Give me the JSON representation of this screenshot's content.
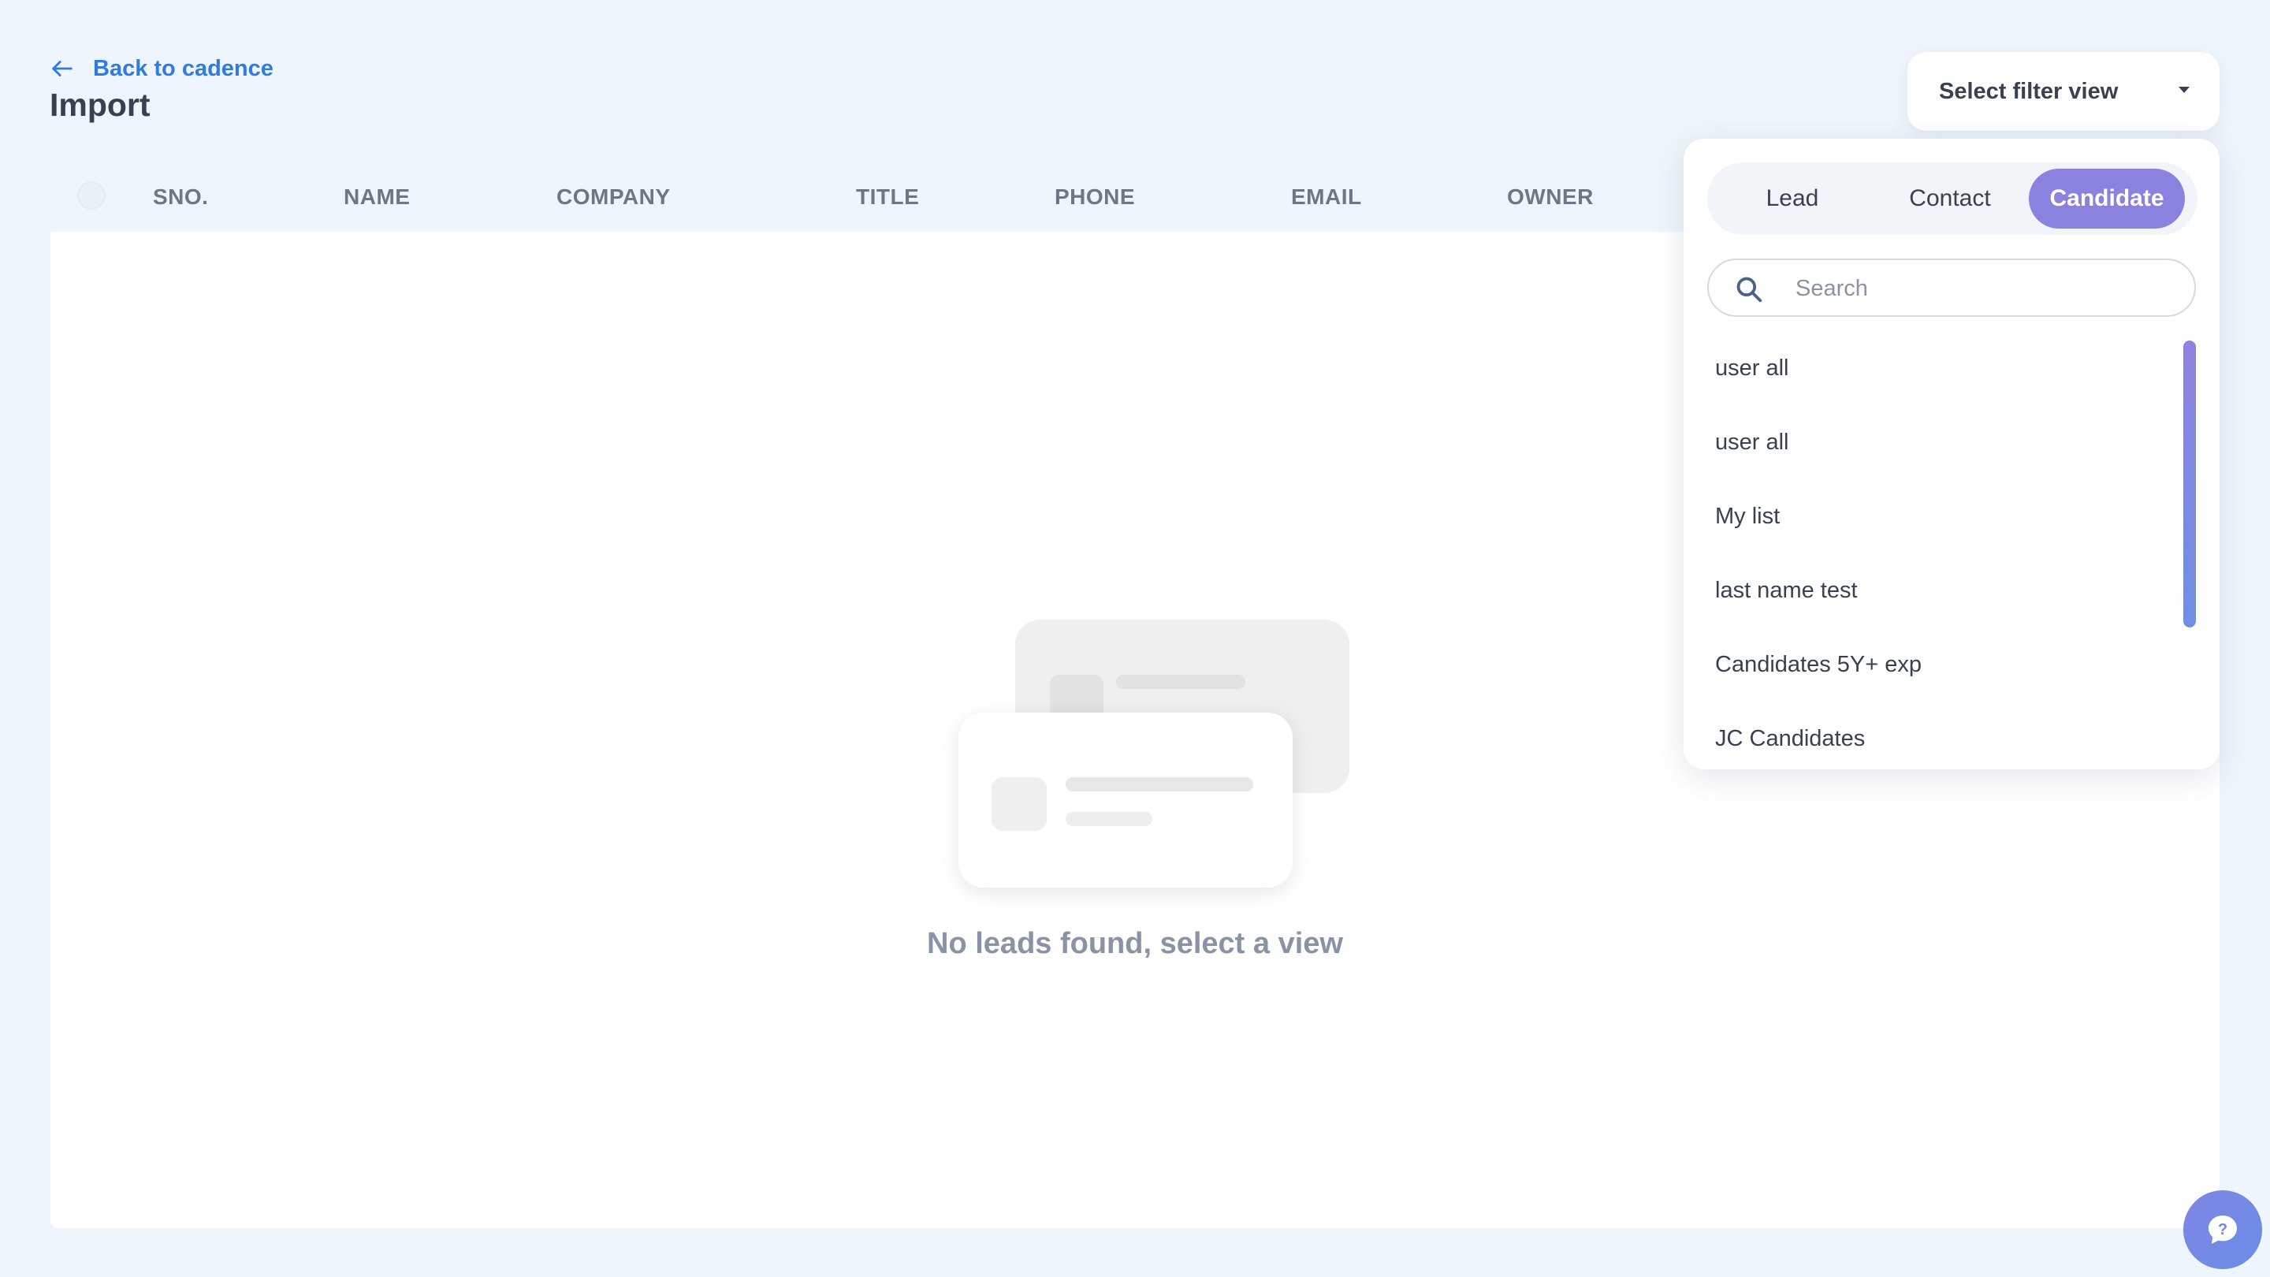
{
  "header": {
    "back_label": "Back to cadence",
    "title": "Import"
  },
  "table": {
    "columns": [
      "SNO.",
      "NAME",
      "COMPANY",
      "TITLE",
      "PHONE",
      "EMAIL",
      "OWNER"
    ],
    "empty_message": "No leads found, select a view"
  },
  "filter": {
    "select_label": "Select filter view",
    "tabs": [
      "Lead",
      "Contact",
      "Candidate"
    ],
    "active_tab": "Candidate",
    "search_placeholder": "Search",
    "items": [
      "user all",
      "user all",
      "My list",
      "last name test",
      "Candidates 5Y+ exp",
      "JC Candidates"
    ]
  },
  "colors": {
    "accent": "#8a82df",
    "link": "#2f7be3",
    "background": "#eff5fc"
  },
  "icons": {
    "back": "arrow-left-icon",
    "search": "search-icon",
    "caret": "caret-down-icon",
    "chat": "chat-help-icon"
  }
}
